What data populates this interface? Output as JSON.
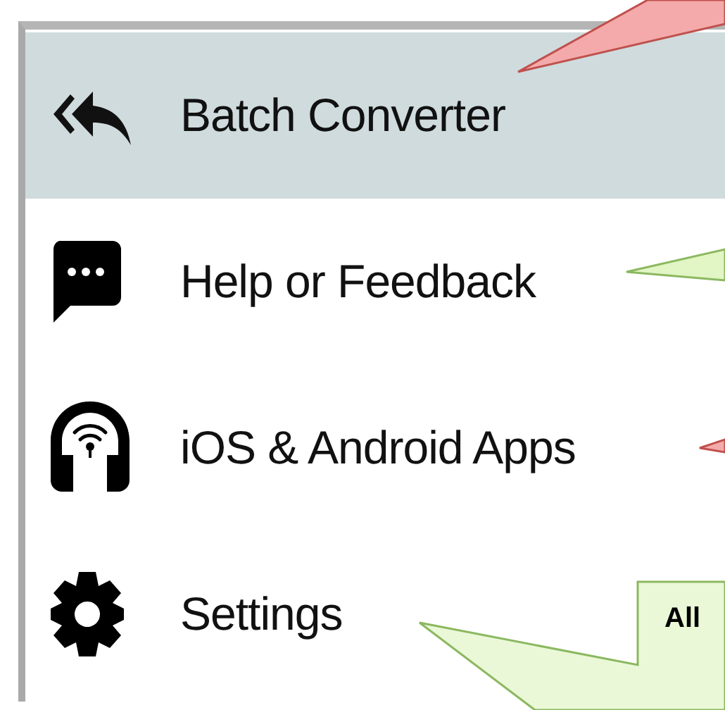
{
  "menu": {
    "items": [
      {
        "label": "Batch Converter",
        "selected": true
      },
      {
        "label": "Help or Feedback",
        "selected": false
      },
      {
        "label": "iOS & Android Apps",
        "selected": false
      },
      {
        "label": "Settings",
        "selected": false
      }
    ]
  },
  "callouts": [
    {
      "color": "#f4aaaa"
    },
    {
      "color": "#e2f5c4"
    },
    {
      "color": "#f4aaaa"
    },
    {
      "color": "#eaf8d8",
      "text": "All"
    }
  ]
}
